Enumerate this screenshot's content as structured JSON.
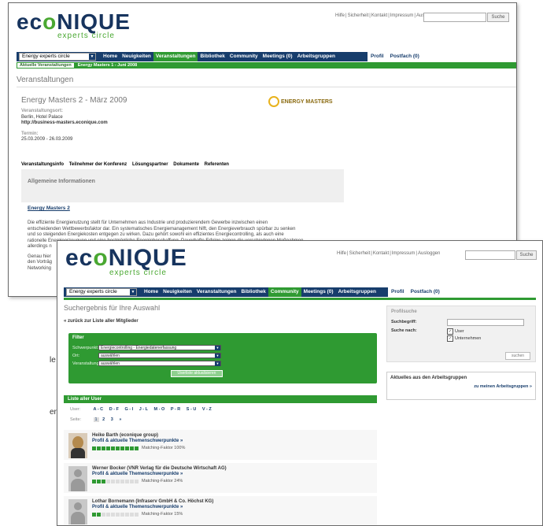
{
  "brand": {
    "name_pre": "ec",
    "name_o": "o",
    "name_post": "NIQUE",
    "tagline": "experts circle"
  },
  "colors": {
    "navy": "#173d6c",
    "green": "#2f9a32"
  },
  "toplinks": [
    "Hilfe",
    "Sicherheit",
    "Kontakt",
    "Impressum",
    "Ausloggen"
  ],
  "search_button": "Suche",
  "nav": {
    "selector": "Energy experts circle",
    "items": [
      "Home",
      "Neuigkeiten",
      "Veranstaltungen",
      "Bibliothek",
      "Community",
      "Meetings (0)",
      "Arbeitsgruppen"
    ],
    "right": [
      "Profil",
      "Postfach (0)"
    ]
  },
  "win1": {
    "subtabs": [
      "Aktuelle Veranstaltungen",
      "Energy Masters 1 - Juni 2008"
    ],
    "page_title": "Veranstaltungen",
    "event_title": "Energy Masters 2 - März 2009",
    "logo_text": "ENERGY MASTERS",
    "location_label": "Veranstaltungsort:",
    "location": "Berlin, Hotel Palace",
    "url": "http://business-masters.econique.com",
    "date_label": "Termin:",
    "dates": "25.03.2009 - 26.03.2009",
    "section_tabs": [
      "Veranstaltungsinfo",
      "Teilnehmer der Konferenz",
      "Lösungspartner",
      "Dokumente",
      "Referenten"
    ],
    "info_heading": "Allgemeine Informationen",
    "link_heading": "Energy Masters 2",
    "body_lines": [
      "Die effiziente Energienutzung stellt für Unternehmen aus Industrie und produzierendem Gewerbe inzwischen einen",
      "entscheidenden Wettbewerbsfaktor dar. Ein systematisches Energiemanagement hilft, den Energieverbrauch spürbar zu senken",
      "und so steigenden Energiekosten entgegen zu wirken. Dazu gehört sowohl ein effizientes Energiecontrolling, als auch eine",
      "rationelle Energieerzeugung und eine bestmögliche Energiebeschaffung. Dauerhafte Erfolge zeigen die verschiedenen Maßnahmen",
      "allerdings n"
    ],
    "body_lines2": [
      "Genau hier",
      "den Vorträg",
      "Networking"
    ]
  },
  "left_fragments": [
    "le",
    "er"
  ],
  "win2": {
    "page_title": "Suchergebnis für Ihre Auswahl",
    "back_link": "« zurück zur Liste aller Mitglieder",
    "filter": {
      "title": "Filter",
      "rows": [
        {
          "label": "Schwerpunkt:",
          "value": "Energiecontrolling - Energiedatenerfassung"
        },
        {
          "label": "Ort:",
          "value": "auswählen"
        },
        {
          "label": "Veranstaltung:",
          "value": "auswählen"
        }
      ],
      "button": "Userliste aktualisieren"
    },
    "list_title": "Liste aller User",
    "alpha_label": "User:",
    "alpha": [
      "A - C",
      "D - F",
      "G - I",
      "J - L",
      "M - O",
      "P - R",
      "S - U",
      "V - Z"
    ],
    "page_label": "Seite:",
    "pages": [
      "1",
      "2",
      "3",
      "»"
    ],
    "users": [
      {
        "name": "Heike Barth (econique group)",
        "link": "Profil & aktuelle Themenschwerpunkte »",
        "match": "Matching-Faktor 100%",
        "level": 10
      },
      {
        "name": "Werner Bocker (VNR Verlag für die Deutsche Wirtschaft AG)",
        "link": "Profil & aktuelle Themenschwerpunkte »",
        "match": "Matching-Faktor 24%",
        "level": 3
      },
      {
        "name": "Lothar Bornemann (Infraserv GmbH & Co. Höchst KG)",
        "link": "Profil & aktuelle Themenschwerpunkte »",
        "match": "Matching-Faktor 15%",
        "level": 2
      }
    ],
    "profile_search": {
      "title": "Profilsuche",
      "term_label": "Suchbegriff:",
      "for_label": "Suche nach:",
      "options": [
        {
          "label": "User",
          "checked": true
        },
        {
          "label": "Unternehmen",
          "checked": true
        }
      ],
      "button": "suchen"
    },
    "groups": {
      "title": "Aktuelles aus den Arbeitsgruppen",
      "link": "zu meinen Arbeitsgruppen »"
    }
  }
}
